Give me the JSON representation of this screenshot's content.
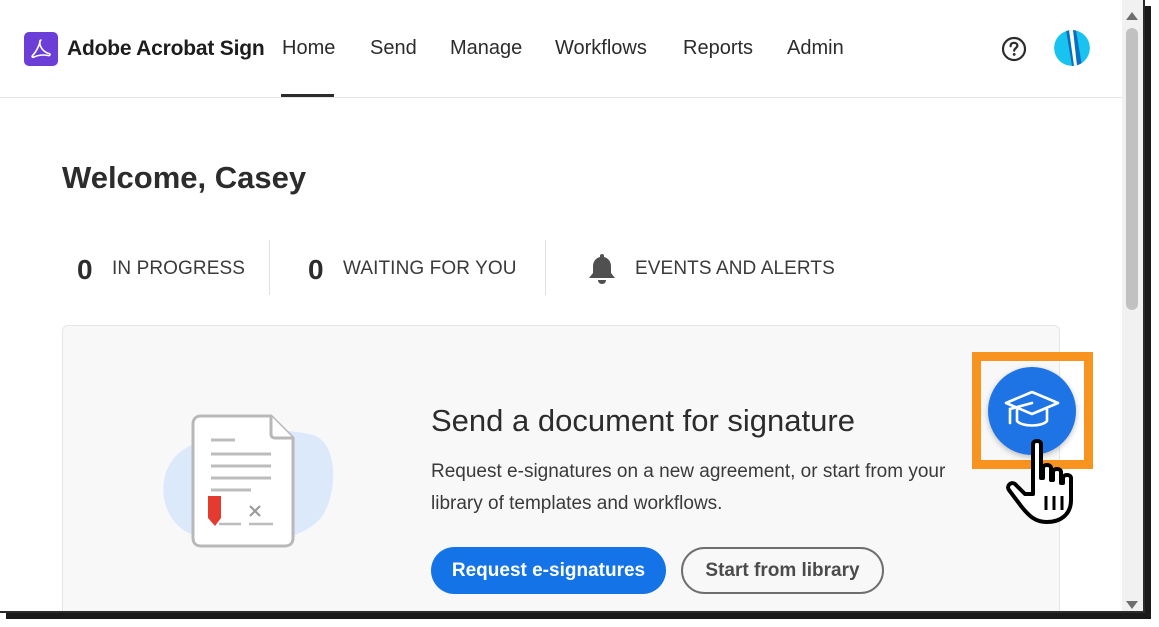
{
  "app": {
    "brand": "Adobe Acrobat Sign",
    "accent_color": "#1473e6",
    "logo_color": "#6b3ed8"
  },
  "nav": {
    "items": [
      {
        "label": "Home",
        "active": true
      },
      {
        "label": "Send"
      },
      {
        "label": "Manage"
      },
      {
        "label": "Workflows"
      },
      {
        "label": "Reports"
      },
      {
        "label": "Admin"
      }
    ],
    "help_icon": "help-circle-icon",
    "avatar_icon": "user-avatar"
  },
  "welcome": {
    "title": "Welcome, Casey"
  },
  "stats": {
    "in_progress": {
      "count": "0",
      "label": "IN PROGRESS"
    },
    "waiting": {
      "count": "0",
      "label": "WAITING FOR YOU"
    },
    "events": {
      "icon": "bell-icon",
      "label": "EVENTS AND ALERTS"
    }
  },
  "card": {
    "title": "Send a document for signature",
    "description_line1": "Request e-signatures on a new agreement, or start from your",
    "description_line2": "library of templates and workflows.",
    "primary_button": "Request e-signatures",
    "secondary_button": "Start from library"
  },
  "learn": {
    "icon": "graduation-cap-icon",
    "highlight_color": "#f7931e"
  }
}
